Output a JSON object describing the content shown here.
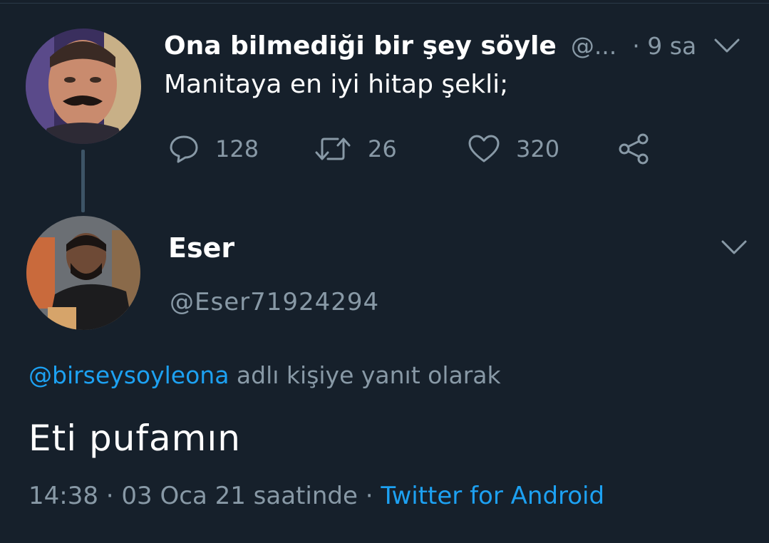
{
  "parent_tweet": {
    "display_name": "Ona bilmediği bir şey söyle",
    "handle": "@...",
    "separator": "·",
    "time": "9 sa",
    "text": "Manitaya en iyi hitap şekli;",
    "actions": {
      "reply_count": "128",
      "retweet_count": "26",
      "like_count": "320"
    },
    "icons": {
      "reply": "reply-icon",
      "retweet": "retweet-icon",
      "like": "heart-icon",
      "share": "share-icon",
      "menu": "chevron-down-icon"
    }
  },
  "reply_tweet": {
    "display_name": "Eser",
    "handle": "@Eser71924294",
    "replying_to_mention": "@birseysoyleona",
    "replying_to_suffix": "adlı kişiye yanıt olarak",
    "text": "Eti pufamın",
    "time": "14:38",
    "meta_sep1": "·",
    "date_text": "03 Oca 21 saatinde",
    "meta_sep2": "·",
    "client": "Twitter for Android",
    "icons": {
      "menu": "chevron-down-icon"
    }
  },
  "colors": {
    "background": "#16202b",
    "text_primary": "#ffffff",
    "text_secondary": "#8899a6",
    "accent": "#1da1f2",
    "thread_line": "#3d5466"
  }
}
